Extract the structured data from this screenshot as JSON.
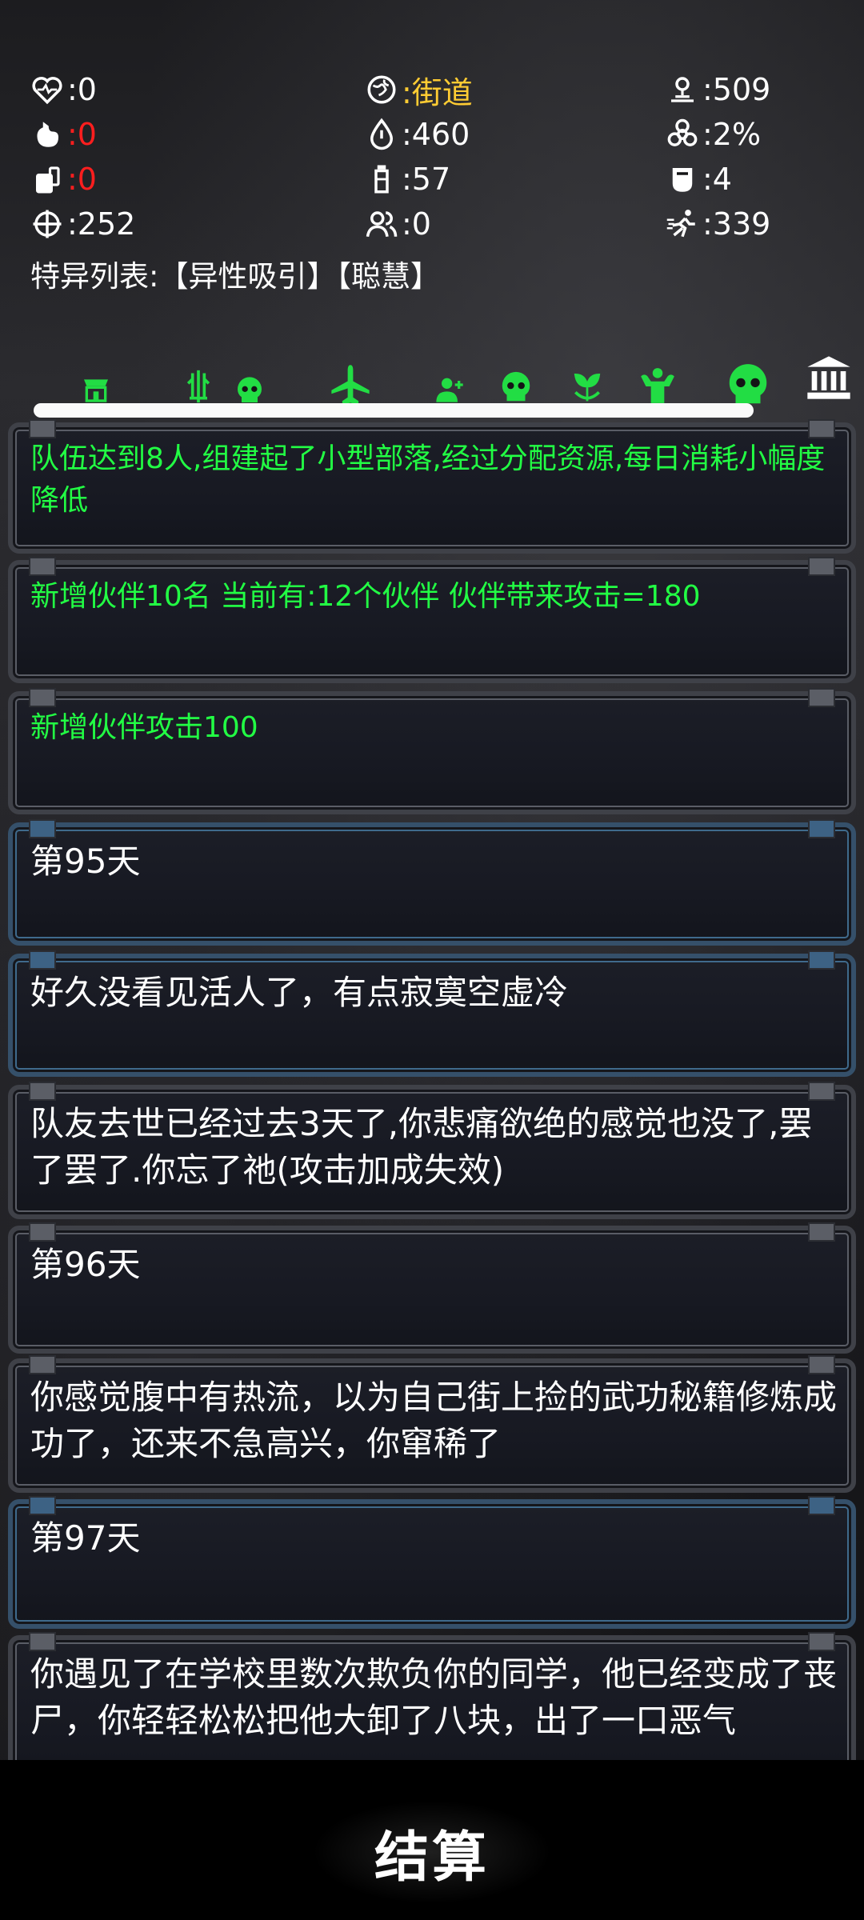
{
  "stats": {
    "health": ":0",
    "location": ":街道",
    "distance": ":509",
    "hunger": ":0",
    "water": ":460",
    "infection": ":2%",
    "food_supply": ":0",
    "bottle": ":57",
    "mask": ":4",
    "attack": ":252",
    "companions": ":0",
    "speed": ":339"
  },
  "traits_text": "特异列表:【异性吸引】【聪慧】",
  "toolbar": {
    "icons": [
      "shop-icon",
      "weapon-icon",
      "skull-small-icon",
      "airplane-icon",
      "recruit-icon",
      "skull-icon",
      "plant-icon",
      "muscle-icon",
      "skull-large-icon",
      "bank-icon"
    ],
    "colors": {
      "green": "#22dd44",
      "white": "#ffffff"
    }
  },
  "progress": {
    "value": 0.83
  },
  "log": [
    {
      "text": "队伍达到8人,组建起了小型部落,经过分配资源,每日消耗小幅度降低",
      "style": "green"
    },
    {
      "text": "新增伙伴10名  当前有:12个伙伴  伙伴带来攻击=180",
      "style": "green"
    },
    {
      "text": "新增伙伴攻击100",
      "style": "green"
    },
    {
      "text": "第95天",
      "style": "white"
    },
    {
      "text": "好久没看见活人了，有点寂寞空虚冷",
      "style": "white"
    },
    {
      "text": "队友去世已经过去3天了,你悲痛欲绝的感觉也没了,罢了罢了.你忘了祂(攻击加成失效)",
      "style": "white"
    },
    {
      "text": "第96天",
      "style": "white"
    },
    {
      "text": "你感觉腹中有热流，以为自己街上捡的武功秘籍修炼成功了，还来不急高兴，你窜稀了",
      "style": "white"
    },
    {
      "text": "第97天",
      "style": "white"
    },
    {
      "text": "你遇见了在学校里数次欺负你的同学，他已经变成了丧尸，你轻轻松松把他大卸了八块，出了一口恶气",
      "style": "white"
    }
  ],
  "settle_button": "结算",
  "colors": {
    "green_text": "#22ff44",
    "red_value": "#ff1e1e",
    "gold_value": "#ffcc33"
  }
}
